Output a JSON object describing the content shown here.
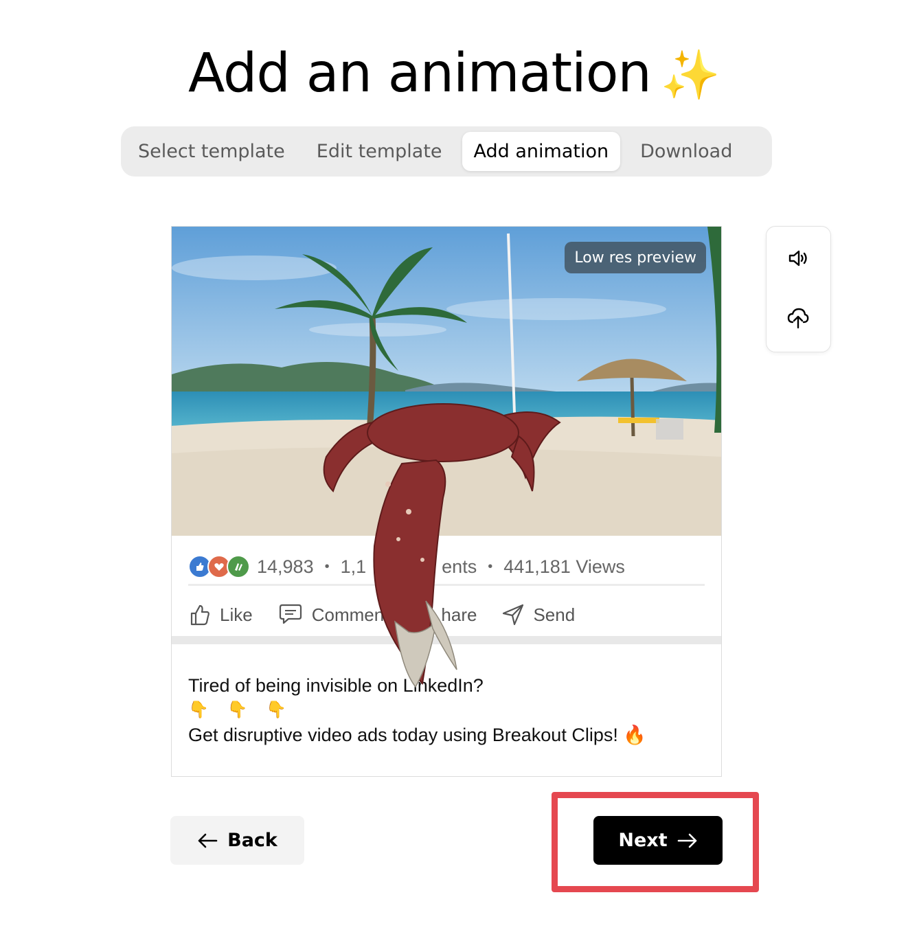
{
  "header": {
    "title": "Add an animation",
    "title_emoji": "✨"
  },
  "stepper": {
    "steps": [
      {
        "label": "Select template",
        "active": false
      },
      {
        "label": "Edit template",
        "active": false
      },
      {
        "label": "Add animation",
        "active": true
      },
      {
        "label": "Download",
        "active": false
      }
    ]
  },
  "preview": {
    "badge": "Low res preview",
    "stats": {
      "reactions": "14,983",
      "comments_partial_left": "1,1",
      "comments_partial_right": "ents",
      "views": "441,181 Views"
    },
    "actions": {
      "like": "Like",
      "comment": "Comment",
      "share_partial": "hare",
      "send": "Send"
    },
    "caption": {
      "line1": "Tired of being invisible on LinkedIn?",
      "emoji_row": "👇 👇 👇",
      "line3": "Get disruptive video ads today using Breakout Clips!",
      "line3_emoji": "🔥"
    }
  },
  "tools": {
    "sound_icon": "speaker-icon",
    "upload_icon": "cloud-upload-icon"
  },
  "nav": {
    "back_label": "Back",
    "next_label": "Next"
  },
  "colors": {
    "highlight": "#e54850",
    "next_bg": "#000000",
    "stepper_bg": "#ececec"
  }
}
